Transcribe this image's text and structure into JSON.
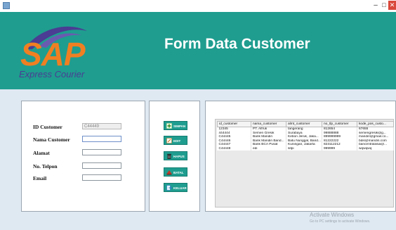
{
  "window": {
    "minimize_glyph": "–",
    "maximize_glyph": "□",
    "close_glyph": "✕"
  },
  "header": {
    "logo_text": "SAP",
    "logo_sub": "Express Courier",
    "title": "Form Data Customer",
    "bg_color": "#1f9d8f",
    "logo_orange": "#f07f22",
    "logo_purple": "#4a3d93"
  },
  "form": {
    "fields": [
      {
        "label": "ID Customer",
        "value": "C44449",
        "state": "disabled"
      },
      {
        "label": "Nama Customer",
        "value": "",
        "state": "focused"
      },
      {
        "label": "Alamat",
        "value": "",
        "state": "normal"
      },
      {
        "label": "No. Telpon",
        "value": "",
        "state": "normal"
      },
      {
        "label": "Email",
        "value": "",
        "state": "normal"
      }
    ]
  },
  "buttons": [
    {
      "label": "SIMPAN",
      "icon": "add-icon"
    },
    {
      "label": "EDIT",
      "icon": "edit-icon"
    },
    {
      "label": "HAPUS",
      "icon": "trash-icon"
    },
    {
      "label": "BATAL",
      "icon": "cancel-icon"
    },
    {
      "label": "KELUAR",
      "icon": "exit-icon"
    }
  ],
  "table": {
    "columns": [
      "id_customer",
      "nama_customer",
      "almt_customer",
      "no_tlp_customer",
      "kode_pos_custo..."
    ],
    "rows": [
      [
        "12345",
        "PT. Alfruk",
        "tangerang",
        "812654",
        "67655"
      ],
      [
        "444444",
        "Semen Gresik",
        "Surabaya",
        "99888888",
        "semengresik@g..."
      ],
      [
        "C44445",
        "Bank Mandiri",
        "Kebon Jeruk, Jaka...",
        "899999999",
        "mandiri@gmail.co..."
      ],
      [
        "C44446",
        "Bank Mandiri Band...",
        "Batu Nunggal, Band...",
        "81222222",
        "bdis@mandiri.com"
      ],
      [
        "C44447",
        "Bank BCA Pusat",
        "Kuningan, Jakarta",
        "823112212",
        "bancentralasia@..."
      ],
      [
        "C44448",
        "edi",
        "sitpi",
        "999999",
        "wqwqwq"
      ]
    ]
  },
  "watermark": {
    "title": "Activate Windows",
    "subtitle": "Go to PC settings to activate Windows."
  }
}
